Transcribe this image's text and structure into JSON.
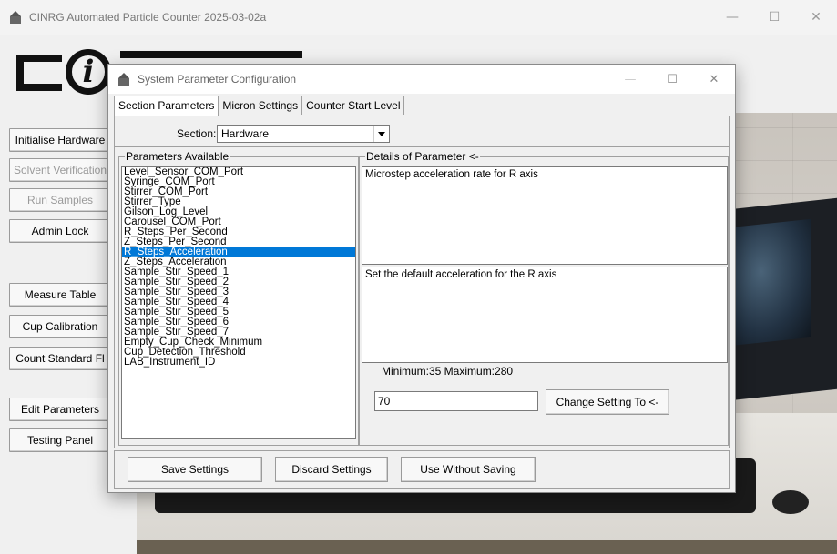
{
  "main_window": {
    "title": "CINRG Automated Particle Counter 2025-03-02a",
    "controls": {
      "minimize": "—",
      "maximize": "☐",
      "close": "✕"
    }
  },
  "left_panel": {
    "buttons": [
      {
        "label": "Initialise Hardware",
        "enabled": true
      },
      {
        "label": "Solvent Verification",
        "enabled": false
      },
      {
        "label": "Run Samples",
        "enabled": false
      },
      {
        "label": "Admin Lock",
        "enabled": true
      },
      {
        "label": "Measure Table",
        "enabled": true
      },
      {
        "label": "Cup Calibration",
        "enabled": true
      },
      {
        "label": "Count Standard Fl",
        "enabled": true
      },
      {
        "label": "Edit Parameters",
        "enabled": true
      },
      {
        "label": "Testing Panel",
        "enabled": true
      }
    ]
  },
  "dialog": {
    "title": "System Parameter Configuration",
    "controls": {
      "minimize": "—",
      "maximize": "☐",
      "close": "✕"
    },
    "tabs": [
      "Section Parameters",
      "Micron Settings",
      "Counter Start Level"
    ],
    "active_tab": 0,
    "section_label": "Section:",
    "section_value": "Hardware",
    "parameters_group_title": "Parameters Available",
    "parameters": [
      "Level_Sensor_COM_Port",
      "Syringe_COM_Port",
      "Stirrer_COM_Port",
      "Stirrer_Type",
      "Gilson_Log_Level",
      "Carousel_COM_Port",
      "R_Steps_Per_Second",
      "Z_Steps_Per_Second",
      "R_Steps_Acceleration",
      "Z_Steps_Acceleration",
      "Sample_Stir_Speed_1",
      "Sample_Stir_Speed_2",
      "Sample_Stir_Speed_3",
      "Sample_Stir_Speed_4",
      "Sample_Stir_Speed_5",
      "Sample_Stir_Speed_6",
      "Sample_Stir_Speed_7",
      "Empty_Cup_Check_Minimum",
      "Cup_Detection_Threshold",
      "LAB_Instrument_ID"
    ],
    "selected_parameter_index": 8,
    "details_group_title": "Details of Parameter <-",
    "details_description": "Microstep acceleration rate for R axis",
    "details_help": "Set the default acceleration for the R axis",
    "min_max_text": "Minimum:35 Maximum:280",
    "value": "70",
    "change_button": "Change Setting To <-",
    "save_button": "Save Settings",
    "discard_button": "Discard Settings",
    "use_without_saving_button": "Use Without Saving"
  },
  "colors": {
    "selection": "#0078d7",
    "window_bg": "#f0f0f0"
  }
}
